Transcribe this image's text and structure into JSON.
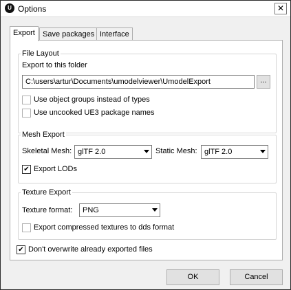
{
  "window": {
    "title": "Options",
    "close_label": "✕"
  },
  "tabs": [
    {
      "label": "Export",
      "active": true
    },
    {
      "label": "Save packages",
      "active": false
    },
    {
      "label": "Interface",
      "active": false
    }
  ],
  "file_layout": {
    "group_title": "File Layout",
    "folder_label": "Export to this folder",
    "folder_value": "C:\\users\\artur\\Documents\\umodelviewer\\UmodelExport",
    "browse_label": "...",
    "use_groups_label": "Use object groups instead of types",
    "use_groups_checked": false,
    "uncooked_label": "Use uncooked UE3 package names",
    "uncooked_checked": false
  },
  "mesh_export": {
    "group_title": "Mesh Export",
    "skeletal_label": "Skeletal Mesh:",
    "skeletal_value": "glTF 2.0",
    "static_label": "Static Mesh:",
    "static_value": "glTF 2.0",
    "export_lods_label": "Export LODs",
    "export_lods_checked": true
  },
  "texture_export": {
    "group_title": "Texture Export",
    "format_label": "Texture format:",
    "format_value": "PNG",
    "compressed_label": "Export compressed textures to dds format",
    "compressed_checked": false
  },
  "dont_overwrite_label": "Don't overwrite already exported files",
  "dont_overwrite_checked": true,
  "buttons": {
    "ok": "OK",
    "cancel": "Cancel"
  }
}
